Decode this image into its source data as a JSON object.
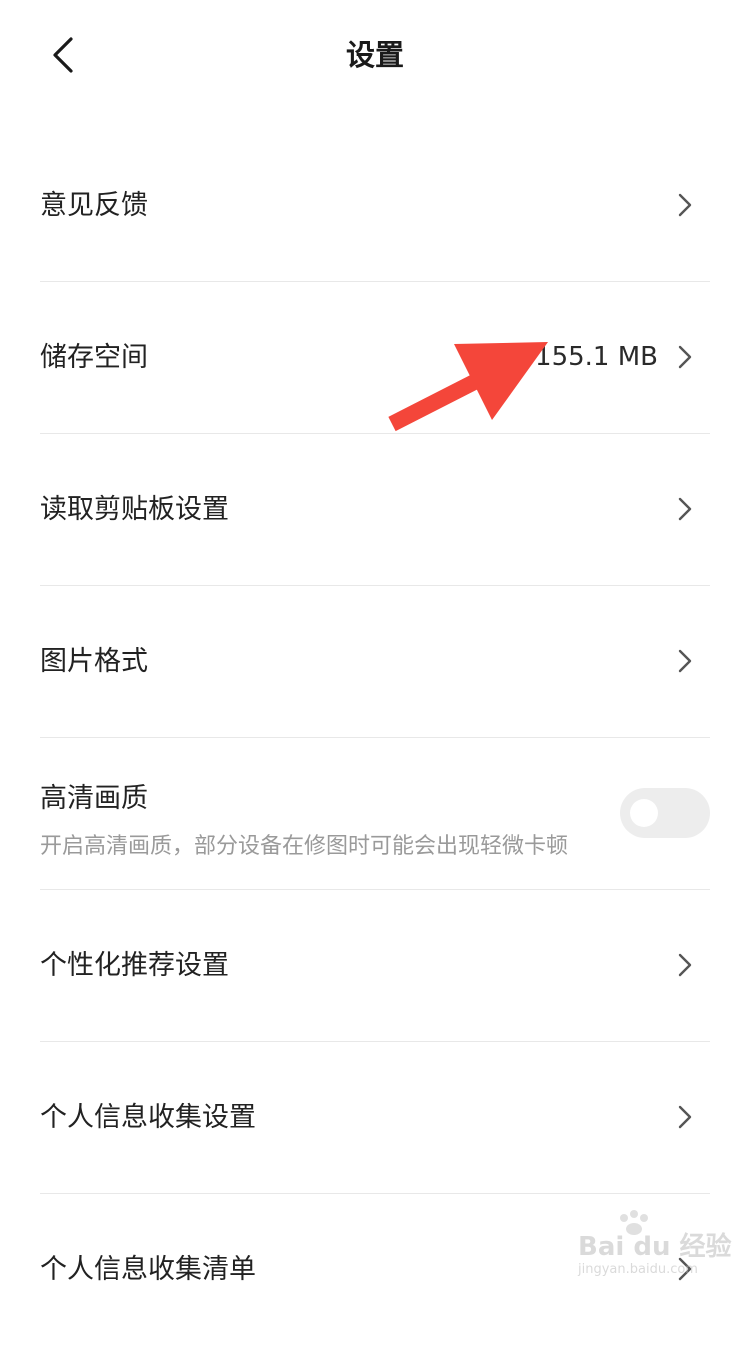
{
  "header": {
    "title": "设置"
  },
  "settings": {
    "feedback": {
      "label": "意见反馈"
    },
    "storage": {
      "label": "储存空间",
      "value": "155.1 MB"
    },
    "clipboard": {
      "label": "读取剪贴板设置"
    },
    "image_format": {
      "label": "图片格式"
    },
    "hd_quality": {
      "label": "高清画质",
      "description": "开启高清画质，部分设备在修图时可能会出现轻微卡顿",
      "enabled": false
    },
    "personalized": {
      "label": "个性化推荐设置"
    },
    "info_collection_settings": {
      "label": "个人信息收集设置"
    },
    "info_collection_list": {
      "label": "个人信息收集清单"
    }
  },
  "watermark": {
    "brand": "Bai du 经验",
    "url": "jingyan.baidu.com"
  },
  "colors": {
    "annotation_arrow": "#f4463a",
    "divider": "#e8e8e8",
    "toggle_off": "#ededed",
    "description_text": "#9a9a9a"
  }
}
